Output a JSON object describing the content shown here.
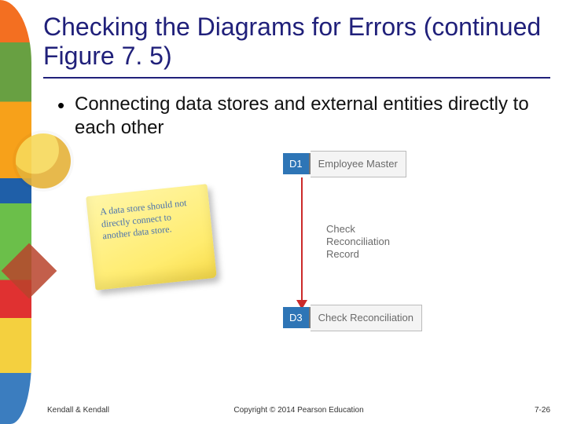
{
  "title": "Checking the Diagrams for Errors (continued Figure 7. 5)",
  "bullet1": "Connecting data stores and external entities directly to each other",
  "sticky_note": "A data store should not directly connect to another data store.",
  "datastore1": {
    "id": "D1",
    "label": "Employee Master"
  },
  "datastore3": {
    "id": "D3",
    "label": "Check Reconciliation"
  },
  "flow_label": "Check\nReconciliation\nRecord",
  "footer": {
    "left": "Kendall & Kendall",
    "center": "Copyright © 2014 Pearson Education",
    "right": "7-26"
  }
}
